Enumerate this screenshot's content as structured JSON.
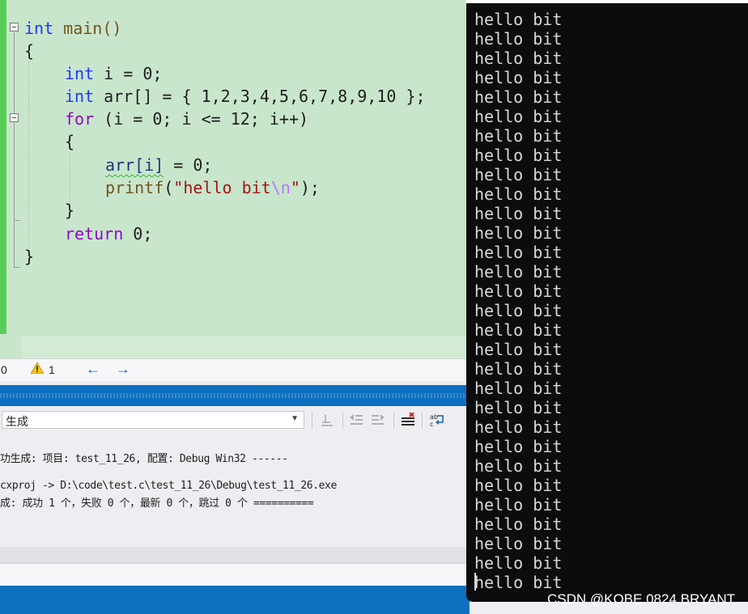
{
  "editor": {
    "code": {
      "l1_kw": "int",
      "l1_fn": "main()",
      "l2": "{",
      "l3_kw": "int",
      "l3_rest": " i = 0;",
      "l4_kw": "int",
      "l4_rest": " arr[] = { 1,2,3,4,5,6,7,8,9,10 };",
      "l5_kw": "for",
      "l5_rest": " (i = 0; i <= 12; i++)",
      "l6": "{",
      "l7_arr": "arr[i]",
      "l7_rest": " = 0;",
      "l8_fn": "printf",
      "l8_open": "(",
      "l8_str": "\"hello bit",
      "l8_esc": "\\n",
      "l8_strend": "\"",
      "l8_close": ");",
      "l9": "}",
      "l10_kw": "return",
      "l10_rest": " 0;",
      "l11": "}"
    }
  },
  "status": {
    "errors": "0",
    "warnings": "1",
    "prev_icon": "arrow-left-icon",
    "next_icon": "arrow-right-icon"
  },
  "output": {
    "source_value": "生成",
    "lines": [
      "功生成: 项目: test_11_26, 配置: Debug Win32 ------",
      "",
      "cxproj -> D:\\code\\test.c\\test_11_26\\Debug\\test_11_26.exe",
      "成: 成功 1 个，失败 0 个，最新 0 个，跳过 0 个 =========="
    ]
  },
  "console": {
    "line": "hello bit",
    "line_count": 30
  },
  "watermark": "CSDN @KOBE 0824 BRYANT",
  "colors": {
    "editor_bg": "#c8e6cc",
    "accent_blue": "#0e70c0",
    "console_bg": "#0c0c0c",
    "keyword": "#1f37ff"
  }
}
